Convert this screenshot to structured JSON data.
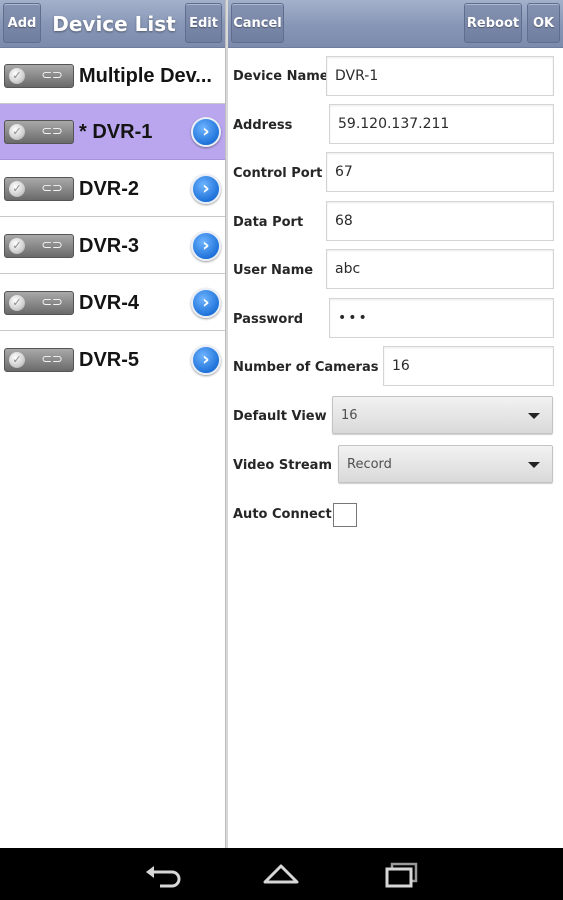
{
  "left_toolbar": {
    "add_label": "Add",
    "title": "Device List",
    "edit_label": "Edit"
  },
  "right_toolbar": {
    "cancel_label": "Cancel",
    "reboot_label": "Reboot",
    "ok_label": "OK"
  },
  "devices": [
    {
      "label": "Multiple Dev..."
    },
    {
      "label": "* DVR-1"
    },
    {
      "label": "DVR-2"
    },
    {
      "label": "DVR-3"
    },
    {
      "label": "DVR-4"
    },
    {
      "label": "DVR-5"
    }
  ],
  "selected_device": "* DVR-1",
  "form": {
    "device_name": {
      "label": "Device Name",
      "value": "DVR-1"
    },
    "address": {
      "label": "Address",
      "value": "59.120.137.211"
    },
    "control_port": {
      "label": "Control Port",
      "value": "67"
    },
    "data_port": {
      "label": "Data Port",
      "value": "68"
    },
    "user_name": {
      "label": "User Name",
      "value": "abc"
    },
    "password": {
      "label": "Password",
      "value": "•••"
    },
    "num_cameras": {
      "label": "Number of Cameras",
      "value": "16"
    },
    "default_view": {
      "label": "Default View",
      "value": "16"
    },
    "video_stream": {
      "label": "Video Stream",
      "value": "Record"
    },
    "auto_connect": {
      "label": "Auto Connect",
      "checked": false
    }
  },
  "icons": {
    "device": "camera-device-icon",
    "detail": "chevron-right-circle-icon",
    "nav_back": "back-icon",
    "nav_home": "home-icon",
    "nav_recents": "recent-apps-icon"
  },
  "colors": {
    "toolbar": "#8796b6",
    "selected_row": "#b9a6ee",
    "chevron": "#1f73da",
    "navbar": "#000000"
  }
}
